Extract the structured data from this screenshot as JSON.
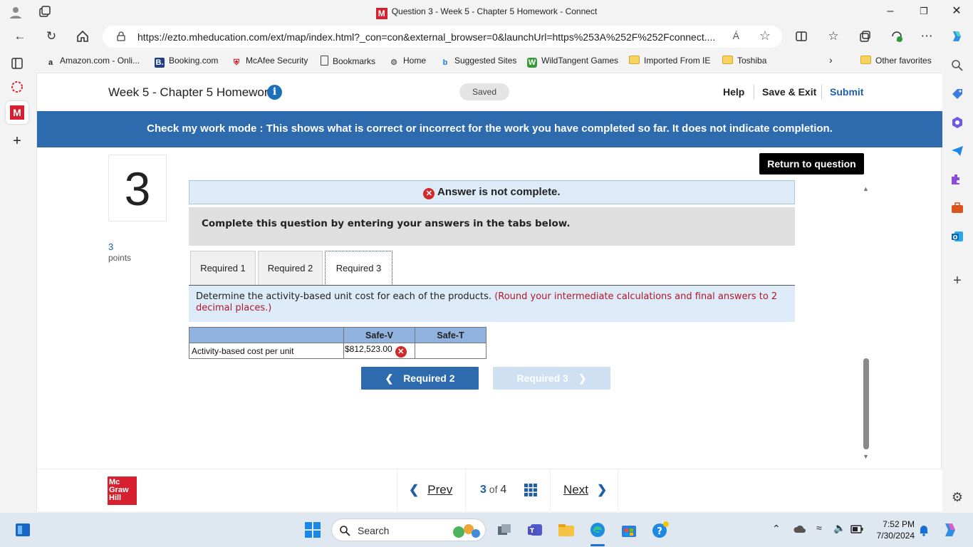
{
  "browser": {
    "window_title": "Question 3 - Week 5 - Chapter 5 Homework - Connect",
    "url": "https://ezto.mheducation.com/ext/map/index.html?_con=con&external_browser=0&launchUrl=https%253A%252F%252Fconnect....",
    "read_aloud": "Á",
    "favorites": [
      {
        "label": "Amazon.com - Onli...",
        "icon": "amazon-icon"
      },
      {
        "label": "Booking.com",
        "icon": "booking-icon"
      },
      {
        "label": "McAfee Security",
        "icon": "mcafee-icon"
      },
      {
        "label": "Bookmarks",
        "icon": "page-icon"
      },
      {
        "label": "Home",
        "icon": "home-fav-icon"
      },
      {
        "label": "Suggested Sites",
        "icon": "bing-icon"
      },
      {
        "label": "WildTangent Games",
        "icon": "wildtangent-icon"
      },
      {
        "label": "Imported From IE",
        "icon": "folder-icon"
      },
      {
        "label": "Toshiba",
        "icon": "folder-icon"
      }
    ],
    "other_favorites": "Other favorites"
  },
  "header": {
    "assignment_title": "Week 5 - Chapter 5 Homework",
    "info_glyph": "i",
    "saved": "Saved",
    "help": "Help",
    "save_exit": "Save & Exit",
    "submit": "Submit"
  },
  "banner": "Check my work mode : This shows what is correct or incorrect for the work you have completed so far. It does not indicate completion.",
  "question": {
    "number": "3",
    "points_value": "3",
    "points_label": "points",
    "return_button": "Return to question",
    "status": "Answer is not complete.",
    "instructions": "Complete this question by entering your answers in the tabs below.",
    "tabs": [
      {
        "label": "Required 1",
        "active": false
      },
      {
        "label": "Required 2",
        "active": false
      },
      {
        "label": "Required 3",
        "active": true
      }
    ],
    "requirement_text": "Determine the activity-based unit cost for each of the products.",
    "requirement_note": "(Round your intermediate calculations and final answers to 2 decimal places.)",
    "table": {
      "headers": [
        "",
        "Safe-V",
        "Safe-T"
      ],
      "rows": [
        {
          "label": "Activity-based cost per unit",
          "safe_v": "$812,523.00",
          "safe_v_status": "incorrect",
          "safe_t": ""
        }
      ]
    },
    "prev_button": "Required 2",
    "next_button": "Required 3"
  },
  "footer": {
    "logo_lines": [
      "Mc",
      "Graw",
      "Hill"
    ],
    "prev": "Prev",
    "current": "3",
    "of_label": "of",
    "total": "4",
    "next": "Next"
  },
  "taskbar": {
    "search_placeholder": "Search",
    "time": "7:52 PM",
    "date": "7/30/2024"
  },
  "colors": {
    "banner": "#2d6aae",
    "error": "#d02b2b",
    "brand_red": "#d6202f",
    "table_header": "#8fb3de"
  }
}
